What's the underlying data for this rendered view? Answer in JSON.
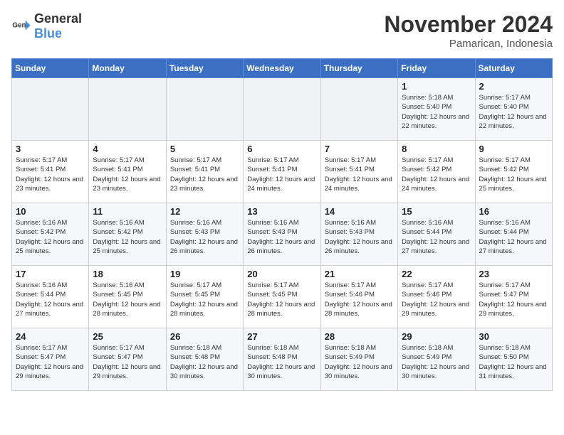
{
  "logo": {
    "text_general": "General",
    "text_blue": "Blue"
  },
  "title": {
    "month": "November 2024",
    "location": "Pamarican, Indonesia"
  },
  "weekdays": [
    "Sunday",
    "Monday",
    "Tuesday",
    "Wednesday",
    "Thursday",
    "Friday",
    "Saturday"
  ],
  "weeks": [
    [
      {
        "day": "",
        "detail": ""
      },
      {
        "day": "",
        "detail": ""
      },
      {
        "day": "",
        "detail": ""
      },
      {
        "day": "",
        "detail": ""
      },
      {
        "day": "",
        "detail": ""
      },
      {
        "day": "1",
        "detail": "Sunrise: 5:18 AM\nSunset: 5:40 PM\nDaylight: 12 hours and 22 minutes."
      },
      {
        "day": "2",
        "detail": "Sunrise: 5:17 AM\nSunset: 5:40 PM\nDaylight: 12 hours and 22 minutes."
      }
    ],
    [
      {
        "day": "3",
        "detail": "Sunrise: 5:17 AM\nSunset: 5:41 PM\nDaylight: 12 hours and 23 minutes."
      },
      {
        "day": "4",
        "detail": "Sunrise: 5:17 AM\nSunset: 5:41 PM\nDaylight: 12 hours and 23 minutes."
      },
      {
        "day": "5",
        "detail": "Sunrise: 5:17 AM\nSunset: 5:41 PM\nDaylight: 12 hours and 23 minutes."
      },
      {
        "day": "6",
        "detail": "Sunrise: 5:17 AM\nSunset: 5:41 PM\nDaylight: 12 hours and 24 minutes."
      },
      {
        "day": "7",
        "detail": "Sunrise: 5:17 AM\nSunset: 5:41 PM\nDaylight: 12 hours and 24 minutes."
      },
      {
        "day": "8",
        "detail": "Sunrise: 5:17 AM\nSunset: 5:42 PM\nDaylight: 12 hours and 24 minutes."
      },
      {
        "day": "9",
        "detail": "Sunrise: 5:17 AM\nSunset: 5:42 PM\nDaylight: 12 hours and 25 minutes."
      }
    ],
    [
      {
        "day": "10",
        "detail": "Sunrise: 5:16 AM\nSunset: 5:42 PM\nDaylight: 12 hours and 25 minutes."
      },
      {
        "day": "11",
        "detail": "Sunrise: 5:16 AM\nSunset: 5:42 PM\nDaylight: 12 hours and 25 minutes."
      },
      {
        "day": "12",
        "detail": "Sunrise: 5:16 AM\nSunset: 5:43 PM\nDaylight: 12 hours and 26 minutes."
      },
      {
        "day": "13",
        "detail": "Sunrise: 5:16 AM\nSunset: 5:43 PM\nDaylight: 12 hours and 26 minutes."
      },
      {
        "day": "14",
        "detail": "Sunrise: 5:16 AM\nSunset: 5:43 PM\nDaylight: 12 hours and 26 minutes."
      },
      {
        "day": "15",
        "detail": "Sunrise: 5:16 AM\nSunset: 5:44 PM\nDaylight: 12 hours and 27 minutes."
      },
      {
        "day": "16",
        "detail": "Sunrise: 5:16 AM\nSunset: 5:44 PM\nDaylight: 12 hours and 27 minutes."
      }
    ],
    [
      {
        "day": "17",
        "detail": "Sunrise: 5:16 AM\nSunset: 5:44 PM\nDaylight: 12 hours and 27 minutes."
      },
      {
        "day": "18",
        "detail": "Sunrise: 5:16 AM\nSunset: 5:45 PM\nDaylight: 12 hours and 28 minutes."
      },
      {
        "day": "19",
        "detail": "Sunrise: 5:17 AM\nSunset: 5:45 PM\nDaylight: 12 hours and 28 minutes."
      },
      {
        "day": "20",
        "detail": "Sunrise: 5:17 AM\nSunset: 5:45 PM\nDaylight: 12 hours and 28 minutes."
      },
      {
        "day": "21",
        "detail": "Sunrise: 5:17 AM\nSunset: 5:46 PM\nDaylight: 12 hours and 28 minutes."
      },
      {
        "day": "22",
        "detail": "Sunrise: 5:17 AM\nSunset: 5:46 PM\nDaylight: 12 hours and 29 minutes."
      },
      {
        "day": "23",
        "detail": "Sunrise: 5:17 AM\nSunset: 5:47 PM\nDaylight: 12 hours and 29 minutes."
      }
    ],
    [
      {
        "day": "24",
        "detail": "Sunrise: 5:17 AM\nSunset: 5:47 PM\nDaylight: 12 hours and 29 minutes."
      },
      {
        "day": "25",
        "detail": "Sunrise: 5:17 AM\nSunset: 5:47 PM\nDaylight: 12 hours and 29 minutes."
      },
      {
        "day": "26",
        "detail": "Sunrise: 5:18 AM\nSunset: 5:48 PM\nDaylight: 12 hours and 30 minutes."
      },
      {
        "day": "27",
        "detail": "Sunrise: 5:18 AM\nSunset: 5:48 PM\nDaylight: 12 hours and 30 minutes."
      },
      {
        "day": "28",
        "detail": "Sunrise: 5:18 AM\nSunset: 5:49 PM\nDaylight: 12 hours and 30 minutes."
      },
      {
        "day": "29",
        "detail": "Sunrise: 5:18 AM\nSunset: 5:49 PM\nDaylight: 12 hours and 30 minutes."
      },
      {
        "day": "30",
        "detail": "Sunrise: 5:18 AM\nSunset: 5:50 PM\nDaylight: 12 hours and 31 minutes."
      }
    ]
  ]
}
